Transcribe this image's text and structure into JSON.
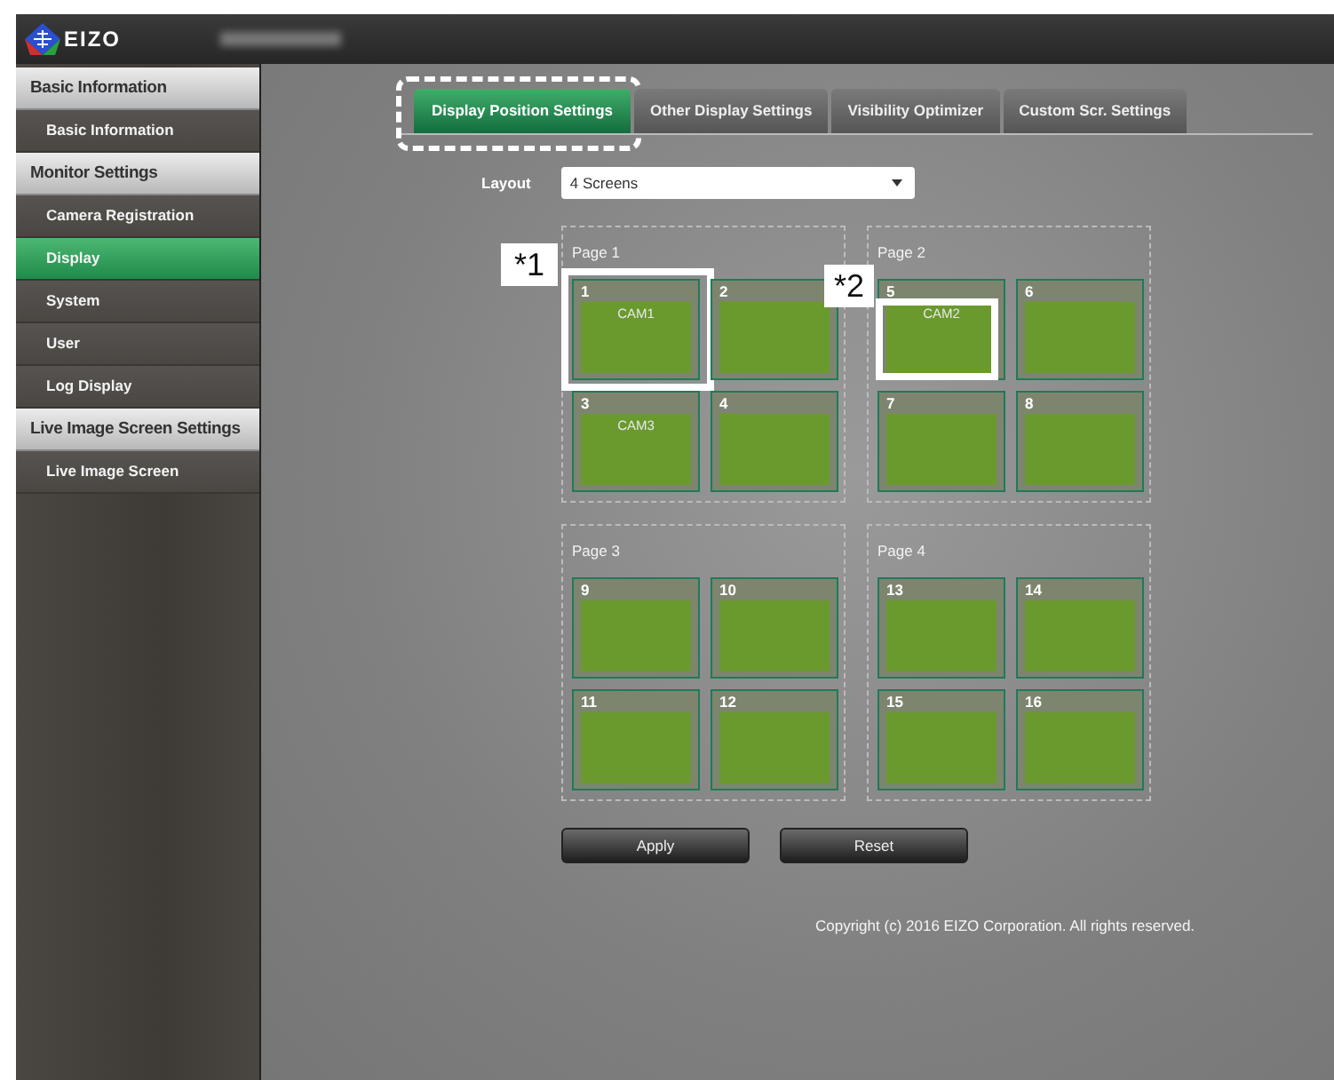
{
  "header": {
    "logo": "EIZO"
  },
  "sidebar": [
    {
      "title": "Basic Information",
      "items": [
        {
          "label": "Basic Information",
          "selected": false
        }
      ]
    },
    {
      "title": "Monitor Settings",
      "items": [
        {
          "label": "Camera Registration",
          "selected": false
        },
        {
          "label": "Display",
          "selected": true
        },
        {
          "label": "System",
          "selected": false
        },
        {
          "label": "User",
          "selected": false
        },
        {
          "label": "Log Display",
          "selected": false
        }
      ]
    },
    {
      "title": "Live Image Screen Settings",
      "items": [
        {
          "label": "Live Image Screen",
          "selected": false
        }
      ]
    }
  ],
  "tabs": [
    {
      "label": "Display Position Settings",
      "selected": true,
      "highlighted": true
    },
    {
      "label": "Other Display Settings",
      "selected": false,
      "highlighted": false
    },
    {
      "label": "Visibility Optimizer",
      "selected": false,
      "highlighted": false
    },
    {
      "label": "Custom Scr. Settings",
      "selected": false,
      "highlighted": false
    }
  ],
  "layout": {
    "label": "Layout",
    "value": "4 Screens"
  },
  "pages": [
    {
      "title": "Page 1",
      "tiles": [
        {
          "number": "1",
          "camera": "CAM1",
          "callout": "*1"
        },
        {
          "number": "2"
        },
        {
          "number": "3",
          "camera": "CAM3"
        },
        {
          "number": "4"
        }
      ]
    },
    {
      "title": "Page 2",
      "tiles": [
        {
          "number": "5",
          "camera": "CAM2",
          "callout": "*2"
        },
        {
          "number": "6"
        },
        {
          "number": "7"
        },
        {
          "number": "8"
        }
      ]
    },
    {
      "title": "Page 3",
      "tiles": [
        {
          "number": "9"
        },
        {
          "number": "10"
        },
        {
          "number": "11"
        },
        {
          "number": "12"
        }
      ]
    },
    {
      "title": "Page 4",
      "tiles": [
        {
          "number": "13"
        },
        {
          "number": "14"
        },
        {
          "number": "15"
        },
        {
          "number": "16"
        }
      ]
    }
  ],
  "buttons": [
    "Apply",
    "Reset"
  ],
  "footer": "Copyright (c) 2016 EIZO Corporation. All rights reserved."
}
